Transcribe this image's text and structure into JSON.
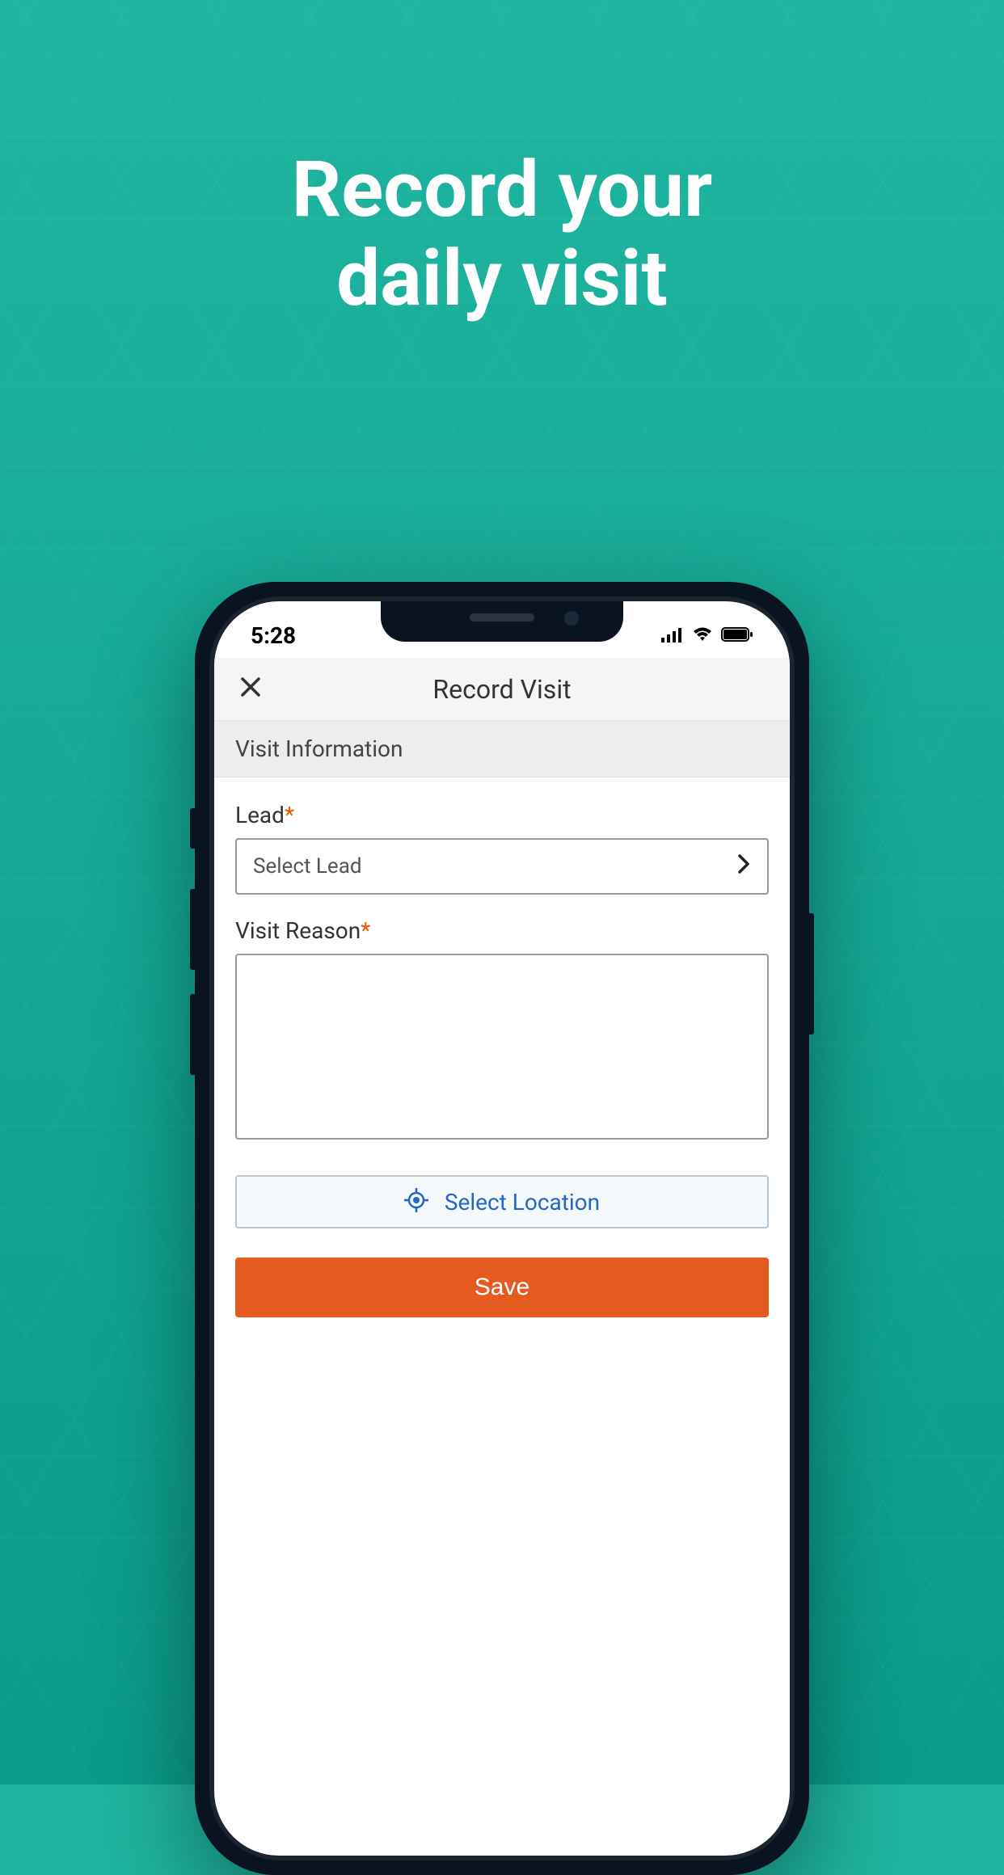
{
  "marketing": {
    "title_line1": "Record your",
    "title_line2": "daily visit"
  },
  "status": {
    "time": "5:28"
  },
  "header": {
    "title": "Record Visit"
  },
  "section": {
    "title": "Visit Information"
  },
  "form": {
    "lead_label": "Lead",
    "lead_placeholder": "Select Lead",
    "reason_label": "Visit Reason",
    "reason_value": "",
    "location_label": "Select Location",
    "save_label": "Save"
  }
}
